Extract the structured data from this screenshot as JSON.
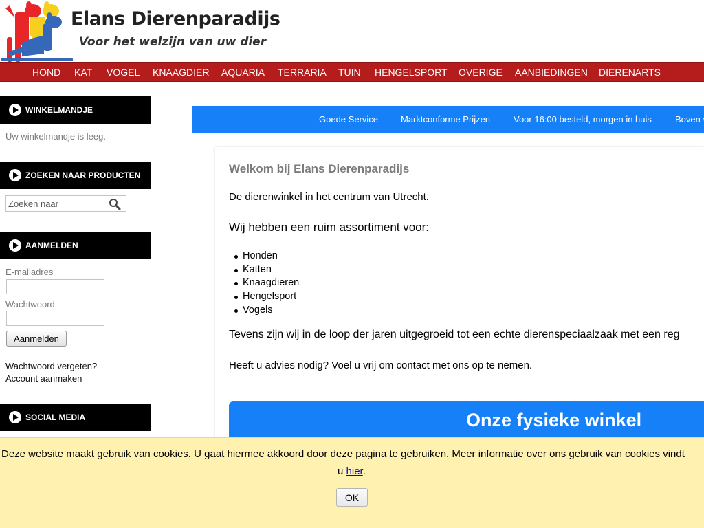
{
  "header": {
    "site_title": "Elans Dierenparadijs",
    "tagline": "Voor het welzijn van uw dier",
    "logo_icon": "dogs-logo-icon",
    "colors": {
      "logo_red": "#e8262a",
      "logo_yellow": "#f6cf1f",
      "logo_blue": "#3568b8"
    }
  },
  "nav": {
    "color": "#b51c1c",
    "items": [
      "HOND",
      "KAT",
      "VOGEL",
      "KNAAGDIER",
      "AQUARIA",
      "TERRARIA",
      "TUIN",
      "HENGELSPORT",
      "OVERIGE",
      "AANBIEDINGEN",
      "DIERENARTS"
    ]
  },
  "sidebar": {
    "cart": {
      "title": "WINKELMANDJE",
      "empty_text": "Uw winkelmandje is leeg."
    },
    "search": {
      "title": "ZOEKEN NAAR PRODUCTEN",
      "placeholder": "Zoeken naar",
      "button_icon": "magnifier-icon"
    },
    "login": {
      "title": "AANMELDEN",
      "email_label": "E-mailadres",
      "email_value": "",
      "password_label": "Wachtwoord",
      "password_value": "",
      "button": "Aanmelden",
      "forgot_link": "Wachtwoord vergeten?",
      "create_link": "Account aanmaken"
    },
    "social": {
      "title": "SOCIAL MEDIA"
    }
  },
  "usp_bar": {
    "color": "#1580f7",
    "items": [
      "Goede Service",
      "Marktconforme Prijzen",
      "Voor 16:00 besteld, morgen in huis",
      "Boven €"
    ]
  },
  "main": {
    "title": "Welkom bij Elans Dierenparadijs",
    "intro": "De dierenwinkel in het centrum van Utrecht.",
    "assortment_intro": "Wij hebben een ruim assortiment voor:",
    "products": [
      "Honden",
      "Katten",
      "Knaagdieren",
      "Hengelsport",
      "Vogels"
    ],
    "grown_text": "Tevens zijn wij in de loop der jaren uitgegroeid tot een echte dierenspeciaalzaak met een reg",
    "advice_text": "Heeft u advies nodig? Voel u vrij om contact met ons op te nemen.",
    "shop_banner_title": "Onze fysieke winkel"
  },
  "cookie": {
    "line1": "Deze website maakt gebruik van cookies. U gaat hiermee akkoord door deze pagina te gebruiken. Meer informatie over ons gebruik van cookies vindt",
    "line2_prefix": "u ",
    "link": "hier",
    "line2_suffix": ".",
    "button": "OK",
    "background": "#fff1b0"
  }
}
